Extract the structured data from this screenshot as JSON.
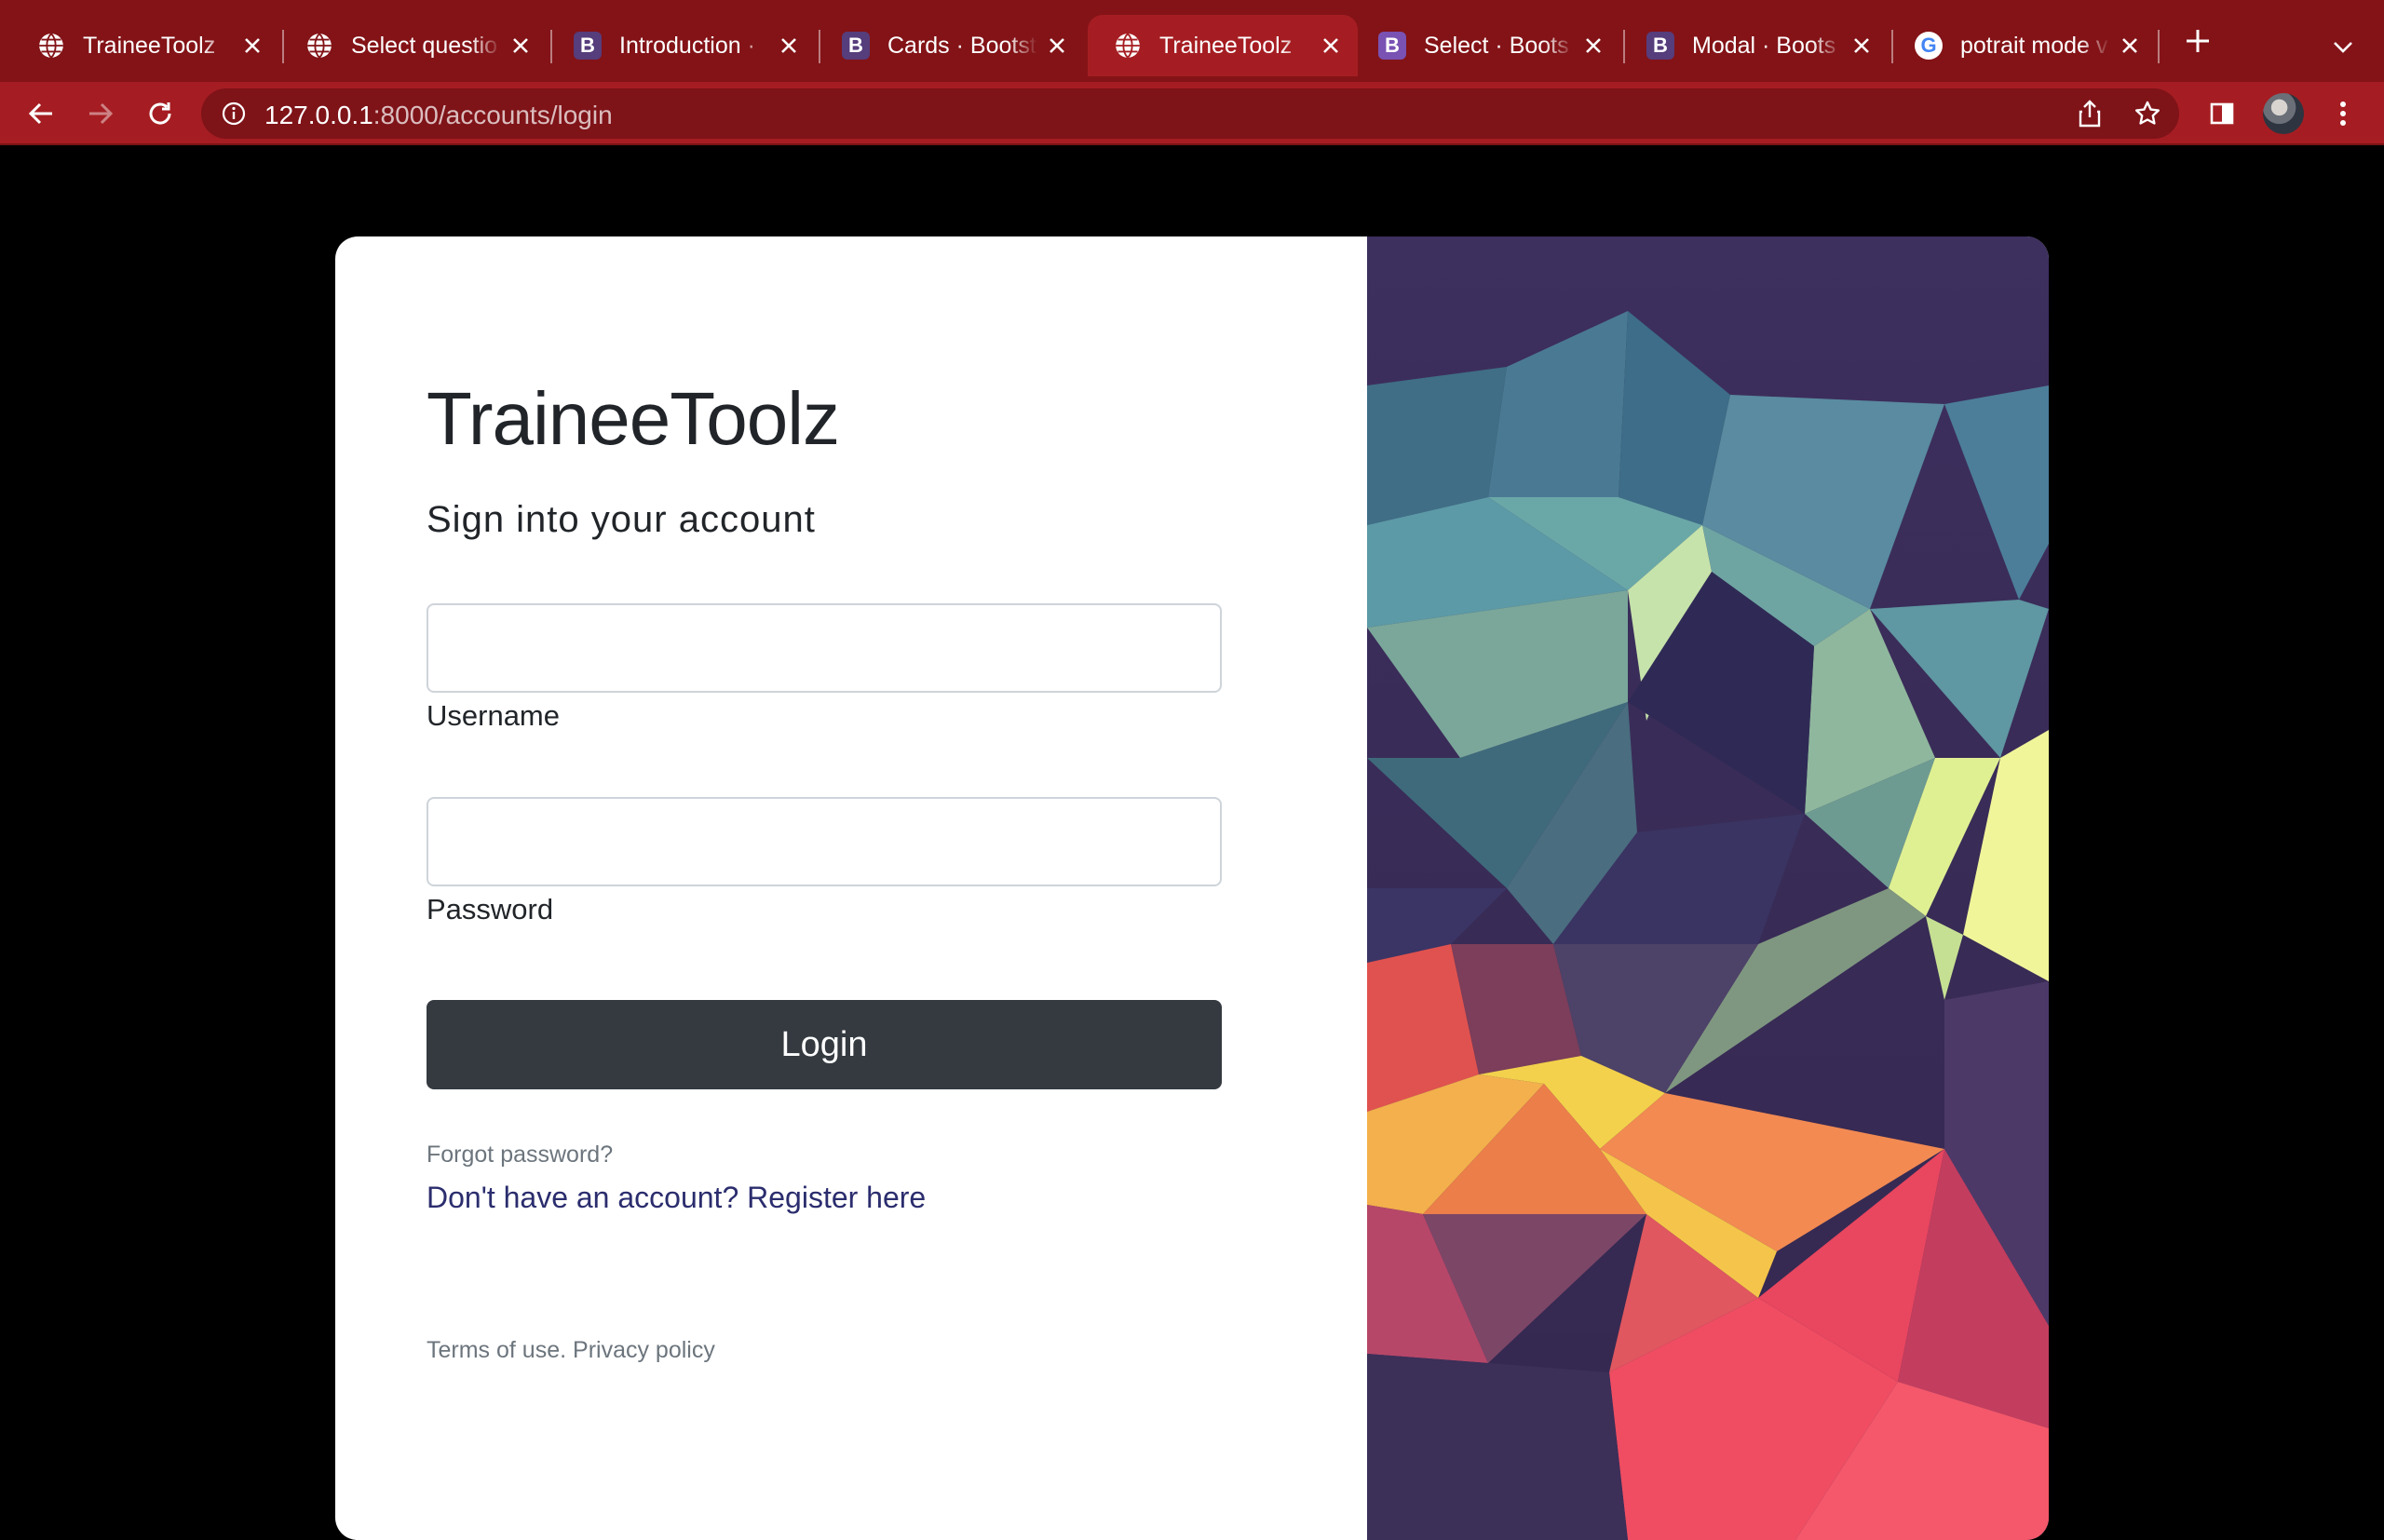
{
  "browser": {
    "tabs": [
      {
        "title": "TraineeToolz",
        "favicon": "globe-icon",
        "active": false
      },
      {
        "title": "Select questio",
        "favicon": "globe-icon",
        "active": false
      },
      {
        "title": "Introduction ·",
        "favicon": "bootstrap-icon",
        "active": false
      },
      {
        "title": "Cards · Bootst",
        "favicon": "bootstrap-icon",
        "active": false
      },
      {
        "title": "TraineeToolz",
        "favicon": "globe-icon",
        "active": true
      },
      {
        "title": "Select · Boots",
        "favicon": "bootstrap-icon",
        "active": false
      },
      {
        "title": "Modal · Boots",
        "favicon": "bootstrap-icon",
        "active": false
      },
      {
        "title": "potrait mode v",
        "favicon": "google-icon",
        "active": false
      }
    ],
    "bootstrap_letter": "B",
    "google_letter": "G",
    "url_host": "127.0.0.1",
    "url_path": ":8000/accounts/login",
    "colors": {
      "tabstrip": "#831317",
      "toolbar": "#a51d22",
      "omnibox": "#7e1318"
    }
  },
  "page": {
    "brand": "TraineeToolz",
    "subtitle": "Sign into your account",
    "username": {
      "label": "Username",
      "value": ""
    },
    "password": {
      "label": "Password",
      "value": ""
    },
    "login_label": "Login",
    "forgot_label": "Forgot password?",
    "register_label": "Don't have an account? Register here",
    "terms_label": "Terms of use.",
    "privacy_label": "Privacy policy",
    "colors": {
      "button": "#343a40",
      "link": "#2b2d6e",
      "muted": "#6c757d"
    }
  }
}
